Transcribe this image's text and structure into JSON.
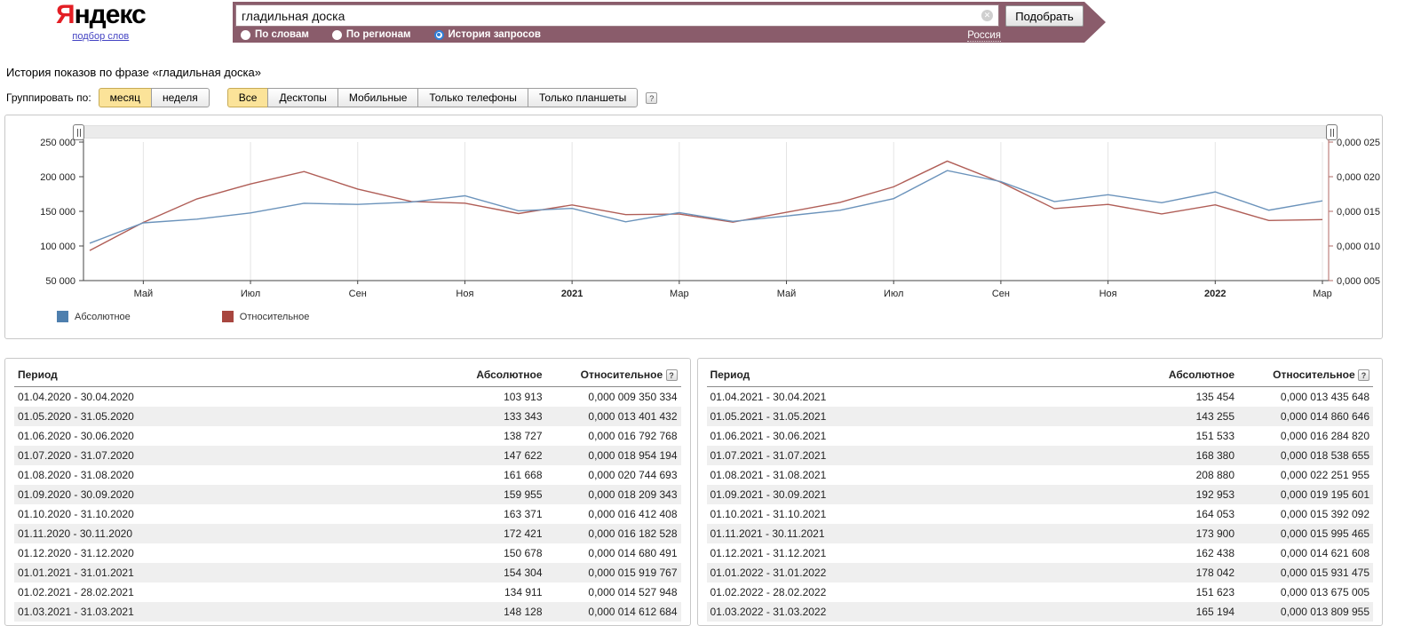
{
  "icons": {
    "clear": "✕",
    "help": "?"
  },
  "header": {
    "logo_ya": "Я",
    "logo_rest": "ндекс",
    "logo_sub": "подбор слов",
    "search": {
      "value": "гладильная доска",
      "button": "Подобрать",
      "region": "Россия"
    },
    "modes": [
      {
        "label": "По словам",
        "selected": false
      },
      {
        "label": "По регионам",
        "selected": false
      },
      {
        "label": "История запросов",
        "selected": true
      }
    ]
  },
  "page_title": "История показов по фразе «гладильная доска»",
  "controls": {
    "group_label": "Группировать по:",
    "group_options": [
      {
        "label": "месяц",
        "active": true
      },
      {
        "label": "неделя",
        "active": false
      }
    ],
    "device_options": [
      {
        "label": "Все",
        "active": true
      },
      {
        "label": "Десктопы",
        "active": false
      },
      {
        "label": "Мобильные",
        "active": false
      },
      {
        "label": "Только телефоны",
        "active": false
      },
      {
        "label": "Только планшеты",
        "active": false
      }
    ]
  },
  "chart_data": {
    "type": "line",
    "title": "История показов по фразе «гладильная доска»",
    "x_months": [
      "04.2020",
      "05.2020",
      "06.2020",
      "07.2020",
      "08.2020",
      "09.2020",
      "10.2020",
      "11.2020",
      "12.2020",
      "01.2021",
      "02.2021",
      "03.2021",
      "04.2021",
      "05.2021",
      "06.2021",
      "07.2021",
      "08.2021",
      "09.2021",
      "10.2021",
      "11.2021",
      "12.2021",
      "01.2022",
      "02.2022",
      "03.2022"
    ],
    "x_tick_labels": [
      "Май",
      "Июл",
      "Сен",
      "Ноя",
      "2021",
      "Мар",
      "Май",
      "Июл",
      "Сен",
      "Ноя",
      "2022",
      "Мар"
    ],
    "left_axis": {
      "tick_labels": [
        "250 000",
        "200 000",
        "150 000",
        "100 000",
        "50 000"
      ],
      "min": 50000,
      "max": 250000
    },
    "right_axis": {
      "tick_labels": [
        "0,000 025",
        "0,000 020",
        "0,000 015",
        "0,000 010",
        "0,000 005"
      ],
      "min_millionths": 5,
      "max_millionths": 25
    },
    "grid": "vertical",
    "legend_position": "bottom-left",
    "series": [
      {
        "name": "Абсолютное",
        "axis": "left",
        "color": "#4e7fae",
        "line_color": "#6b93bb",
        "values": [
          103913,
          133343,
          138727,
          147622,
          161668,
          159955,
          163371,
          172421,
          150678,
          154304,
          134911,
          148128,
          135454,
          143255,
          151533,
          168380,
          208880,
          192953,
          164053,
          173900,
          162438,
          178042,
          151623,
          165194
        ]
      },
      {
        "name": "Относительное",
        "axis": "right",
        "color": "#a8463f",
        "line_color": "#b05e57",
        "values_millionths": [
          9.350334,
          13.401432,
          16.792768,
          18.954194,
          20.744693,
          18.209343,
          16.412408,
          16.182528,
          14.680491,
          15.919767,
          14.527948,
          14.612684,
          13.435648,
          14.860646,
          16.28482,
          18.538655,
          22.251955,
          19.195601,
          15.392092,
          15.995465,
          14.621608,
          15.931475,
          13.675005,
          13.809955
        ]
      }
    ]
  },
  "tables": [
    {
      "headers": [
        "Период",
        "Абсолютное",
        "Относительное"
      ],
      "rows": [
        [
          "01.04.2020 - 30.04.2020",
          "103 913",
          "0,000 009 350 334"
        ],
        [
          "01.05.2020 - 31.05.2020",
          "133 343",
          "0,000 013 401 432"
        ],
        [
          "01.06.2020 - 30.06.2020",
          "138 727",
          "0,000 016 792 768"
        ],
        [
          "01.07.2020 - 31.07.2020",
          "147 622",
          "0,000 018 954 194"
        ],
        [
          "01.08.2020 - 31.08.2020",
          "161 668",
          "0,000 020 744 693"
        ],
        [
          "01.09.2020 - 30.09.2020",
          "159 955",
          "0,000 018 209 343"
        ],
        [
          "01.10.2020 - 31.10.2020",
          "163 371",
          "0,000 016 412 408"
        ],
        [
          "01.11.2020 - 30.11.2020",
          "172 421",
          "0,000 016 182 528"
        ],
        [
          "01.12.2020 - 31.12.2020",
          "150 678",
          "0,000 014 680 491"
        ],
        [
          "01.01.2021 - 31.01.2021",
          "154 304",
          "0,000 015 919 767"
        ],
        [
          "01.02.2021 - 28.02.2021",
          "134 911",
          "0,000 014 527 948"
        ],
        [
          "01.03.2021 - 31.03.2021",
          "148 128",
          "0,000 014 612 684"
        ]
      ]
    },
    {
      "headers": [
        "Период",
        "Абсолютное",
        "Относительное"
      ],
      "rows": [
        [
          "01.04.2021 - 30.04.2021",
          "135 454",
          "0,000 013 435 648"
        ],
        [
          "01.05.2021 - 31.05.2021",
          "143 255",
          "0,000 014 860 646"
        ],
        [
          "01.06.2021 - 30.06.2021",
          "151 533",
          "0,000 016 284 820"
        ],
        [
          "01.07.2021 - 31.07.2021",
          "168 380",
          "0,000 018 538 655"
        ],
        [
          "01.08.2021 - 31.08.2021",
          "208 880",
          "0,000 022 251 955"
        ],
        [
          "01.09.2021 - 30.09.2021",
          "192 953",
          "0,000 019 195 601"
        ],
        [
          "01.10.2021 - 31.10.2021",
          "164 053",
          "0,000 015 392 092"
        ],
        [
          "01.11.2021 - 30.11.2021",
          "173 900",
          "0,000 015 995 465"
        ],
        [
          "01.12.2021 - 31.12.2021",
          "162 438",
          "0,000 014 621 608"
        ],
        [
          "01.01.2022 - 31.01.2022",
          "178 042",
          "0,000 015 931 475"
        ],
        [
          "01.02.2022 - 28.02.2022",
          "151 623",
          "0,000 013 675 005"
        ],
        [
          "01.03.2022 - 31.03.2022",
          "165 194",
          "0,000 013 809 955"
        ]
      ]
    }
  ]
}
